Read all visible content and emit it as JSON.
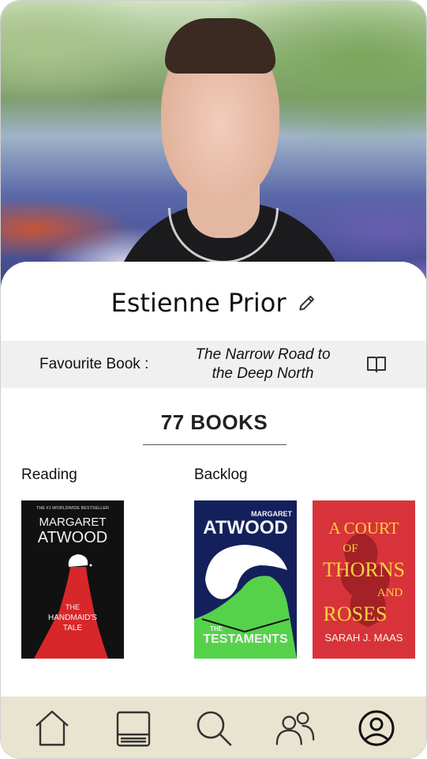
{
  "profile": {
    "name": "Estienne Prior",
    "favourite_label": "Favourite Book :",
    "favourite_title_line1": "The Narrow Road to",
    "favourite_title_line2": "the Deep North",
    "book_count": "77 BOOKS"
  },
  "shelves": {
    "reading_label": "Reading",
    "backlog_label": "Backlog"
  },
  "books": [
    {
      "top_line": "THE #1 WORLDWIDE BESTSELLER",
      "author_line1": "MARGARET",
      "author_line2": "ATWOOD",
      "title_line1": "THE",
      "title_line2": "HANDMAID'S",
      "title_line3": "TALE",
      "bg": "#111111"
    },
    {
      "author_line1": "MARGARET",
      "author_line2": "ATWOOD",
      "title_line1": "THE",
      "title_line2": "TESTAMENTS",
      "bg": "#14205c"
    },
    {
      "title_line1": "A COURT",
      "title_line2": "OF",
      "title_line3": "THORNS",
      "title_line4": "AND",
      "title_line5": "ROSES",
      "author": "SARAH J. MAAS",
      "bg": "#d8333b"
    }
  ],
  "nav": [
    {
      "icon": "home-icon"
    },
    {
      "icon": "book-icon"
    },
    {
      "icon": "search-icon"
    },
    {
      "icon": "friends-icon"
    },
    {
      "icon": "profile-icon",
      "active": true
    }
  ],
  "colors": {
    "nav_bg": "#e8e4cf",
    "fav_band_bg": "#f0f0f0"
  }
}
